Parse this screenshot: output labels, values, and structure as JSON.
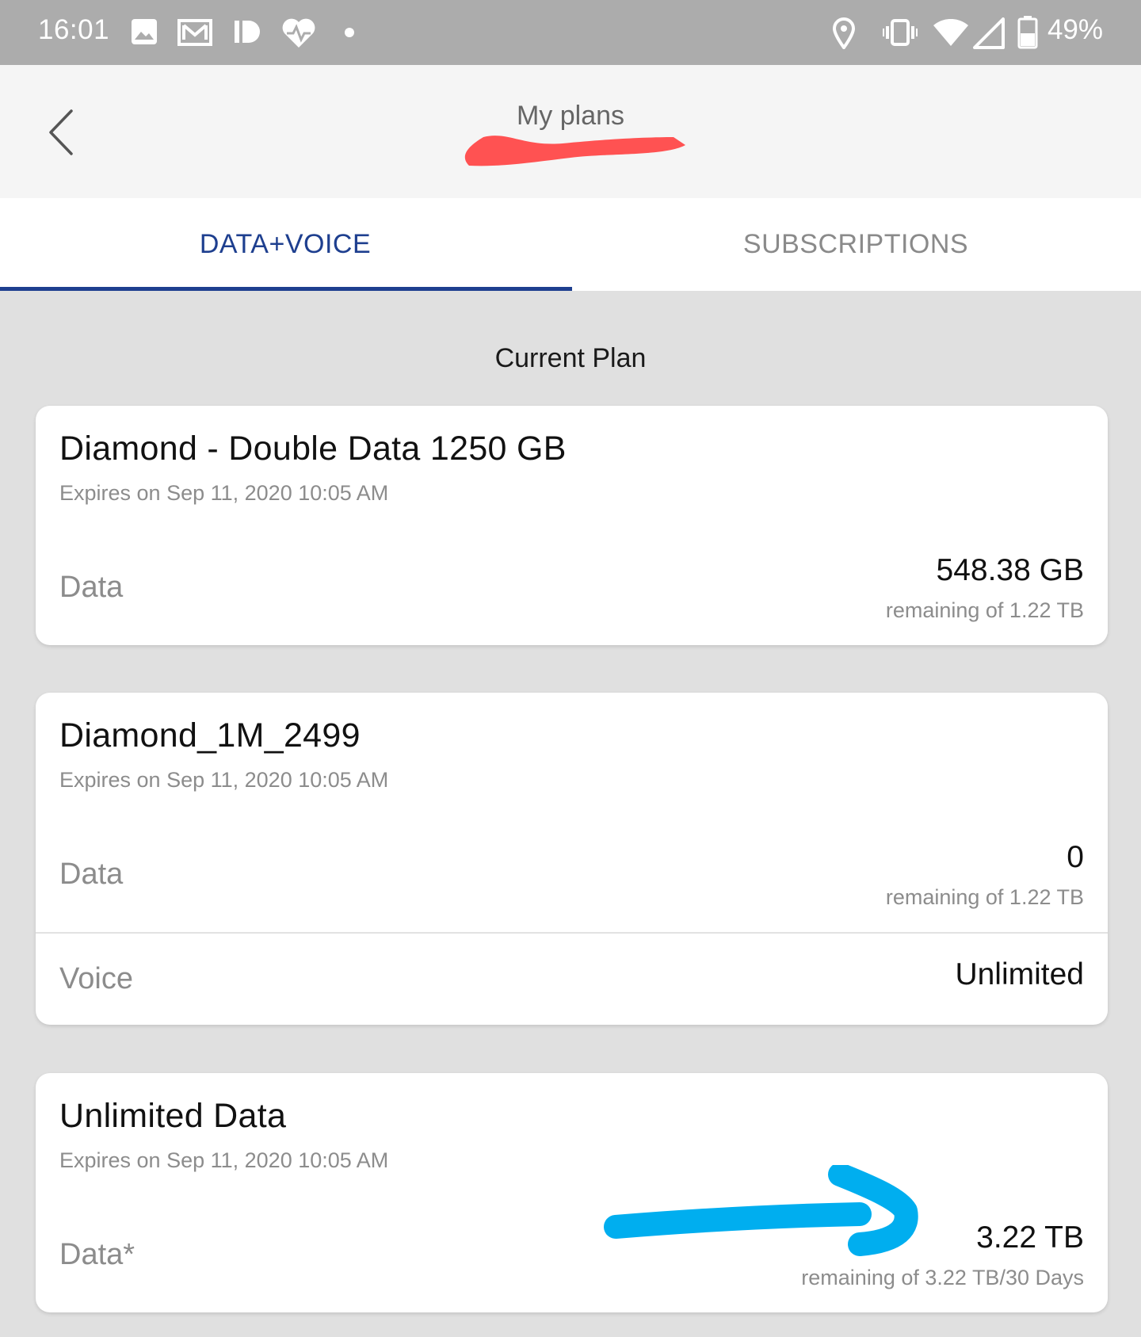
{
  "status_bar": {
    "time": "16:01",
    "battery": "49%",
    "icons_left": [
      "image-icon",
      "mail-icon",
      "id-icon",
      "health-icon",
      "dot-icon"
    ],
    "icons_right": [
      "location-icon",
      "vibrate-icon",
      "wifi-icon",
      "signal-icon",
      "battery-icon"
    ]
  },
  "app_bar": {
    "title": "My plans"
  },
  "tabs": [
    {
      "label": "DATA+VOICE",
      "active": true
    },
    {
      "label": "SUBSCRIPTIONS",
      "active": false
    }
  ],
  "section_title": "Current Plan",
  "plans": [
    {
      "name": "Diamond - Double Data 1250 GB",
      "expiry": "Expires on Sep 11, 2020 10:05 AM",
      "rows": [
        {
          "label": "Data",
          "value": "548.38 GB",
          "sub": "remaining of 1.22 TB"
        }
      ]
    },
    {
      "name": "Diamond_1M_2499",
      "expiry": "Expires on Sep 11, 2020 10:05 AM",
      "rows": [
        {
          "label": "Data",
          "value": "0",
          "sub": "remaining of 1.22 TB"
        },
        {
          "label": "Voice",
          "value": "Unlimited"
        }
      ]
    },
    {
      "name": "Unlimited Data",
      "expiry": "Expires on Sep 11, 2020 10:05 AM",
      "rows": [
        {
          "label": "Data*",
          "value": "3.22 TB",
          "sub": "remaining of 3.22 TB/30 Days"
        }
      ]
    }
  ],
  "colors": {
    "status_bar": "#acacac",
    "accent": "#1e3f8f",
    "redaction": "#ff5252",
    "annotation": "#00aeef"
  }
}
